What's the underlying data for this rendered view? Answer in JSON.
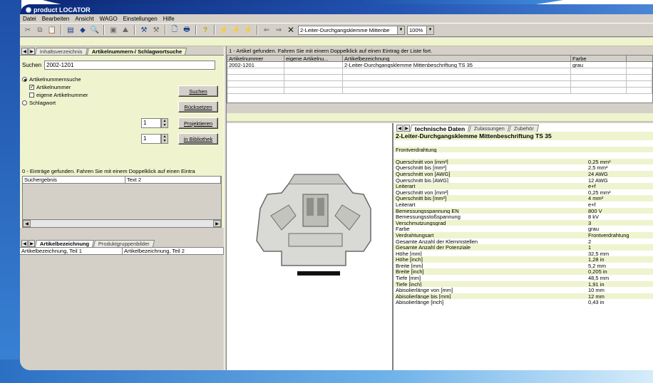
{
  "app": {
    "title": "product LOCATOR"
  },
  "menu": [
    "Datei",
    "Bearbeiten",
    "Ansicht",
    "WAGO",
    "Einstellungen",
    "Hilfe"
  ],
  "toolbar": {
    "product_combo": "2-Leiter-Durchgangsklemme Mittenbe",
    "zoom_combo": "100%"
  },
  "left_tabs": [
    {
      "label": "Inhaltsverzeichnis"
    },
    {
      "label": "Artikelnummern-/ Schlagwortsuche"
    }
  ],
  "search": {
    "label": "Suchen",
    "value": "2002-1201",
    "radio_articlenumber": "Artikelnummernsuche",
    "check_articlenumber": "Artikelnummer",
    "check_own": "eigene Artikelnummer",
    "radio_keyword": "Schlagwort",
    "btn_search": "Suchen",
    "btn_reset": "Rücksetzen",
    "spin1": "1",
    "spin2": "1",
    "btn_project": "Projektieren",
    "btn_library": "in Bibliothek",
    "result_text": "0 - Einträge gefunden. Fahren Sie mit einem Doppelklick auf einen Eintra",
    "col_result": "Suchergebnis",
    "col_text2": "Text 2"
  },
  "bottom_tabs": [
    {
      "label": "Artikelbezeichnung"
    },
    {
      "label": "Produktgruppenbilder"
    }
  ],
  "bottom_list": {
    "col1": "Artikelbezeichnung, Teil 1",
    "col2": "Artikelbezeichnung, Teil 2"
  },
  "results": {
    "info": "1 - Artikel gefunden. Fahren Sie mit einem Doppelklick auf einen Eintrag der Liste fort.",
    "columns": [
      "Artikelnummer",
      "eigene Artikelnu...",
      "Artikelbezeichnung",
      "Farbe"
    ],
    "rows": [
      [
        "2002-1201",
        "",
        "2-Leiter-Durchgangsklemme Mittenbeschriftung TS 35",
        "grau"
      ]
    ]
  },
  "spec_tabs": [
    {
      "label": "technische Daten"
    },
    {
      "label": "Zulassungen"
    },
    {
      "label": "Zubehör"
    }
  ],
  "spec": {
    "title": "2-Leiter-Durchgangsklemme Mittenbeschriftung TS 35",
    "subtitle": "Frontverdrahtung",
    "rows": [
      {
        "k": "Querschnitt von [mm²]",
        "v": "0,25 mm²"
      },
      {
        "k": "Querschnitt bis [mm²]",
        "v": "2,5 mm²"
      },
      {
        "k": "Querschnitt von [AWG]",
        "v": "24 AWG"
      },
      {
        "k": "Querschnitt bis [AWG]",
        "v": "12 AWG"
      },
      {
        "k": "Leiterart",
        "v": "e+f"
      },
      {
        "k": "Querschnitt von [mm²]",
        "v": "0,25 mm²"
      },
      {
        "k": "Querschnitt bis [mm²]",
        "v": "4 mm²"
      },
      {
        "k": "Leiterart",
        "v": "e+f"
      },
      {
        "k": "Bemessungsspannung EN",
        "v": "800 V"
      },
      {
        "k": "Bemessungsstoßspannung",
        "v": "8 kV"
      },
      {
        "k": "Verschmutzungsgrad",
        "v": "3"
      },
      {
        "k": "Farbe",
        "v": "grau"
      },
      {
        "k": "Verdrahtungsart",
        "v": "Frontverdrahtung"
      },
      {
        "k": "Gesamte Anzahl der Klemmstellen",
        "v": "2"
      },
      {
        "k": "Gesamte Anzahl der Potenziale",
        "v": "1"
      },
      {
        "k": "Höhe [mm]",
        "v": "32,5 mm"
      },
      {
        "k": "Höhe [inch]",
        "v": "1,28 in"
      },
      {
        "k": "Breite [mm]",
        "v": "5,2 mm"
      },
      {
        "k": "Breite [inch]",
        "v": "0,205 in"
      },
      {
        "k": "Tiefe [mm]",
        "v": "48,5 mm"
      },
      {
        "k": "Tiefe [inch]",
        "v": "1,91 in"
      },
      {
        "k": "Abisolierlänge von [mm]",
        "v": "10 mm"
      },
      {
        "k": "Abisolierlänge bis [mm]",
        "v": "12 mm"
      },
      {
        "k": "Abisolierlänge [inch]",
        "v": "0,43 in"
      }
    ]
  }
}
